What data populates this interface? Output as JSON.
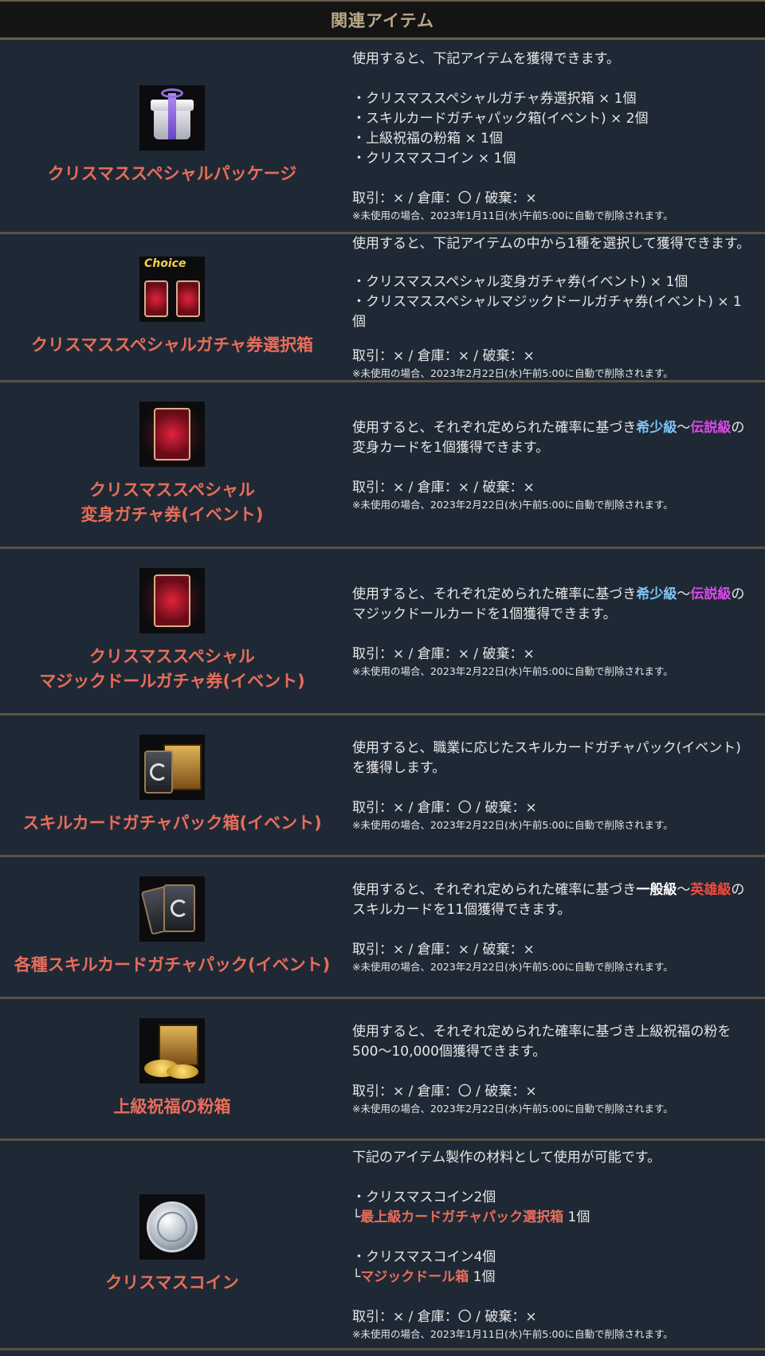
{
  "header": {
    "title": "関連アイテム"
  },
  "items": [
    {
      "name": "クリスマススペシャルパッケージ",
      "icon": "gift-box-icon",
      "lines": [
        "使用すると、下記アイテムを獲得できます。",
        "",
        "・クリスマススペシャルガチャ券選択箱 × 1個",
        "・スキルカードガチャパック箱(イベント) × 2個",
        "・上級祝福の粉箱 × 1個",
        "・クリスマスコイン × 1個",
        ""
      ],
      "trade": "取引：× / 倉庫：〇 / 破棄：×",
      "note": "※未使用の場合、2023年1月11日(水)午前5:00に自動で削除されます。"
    },
    {
      "name": "クリスマススペシャルガチャ券選択箱",
      "icon": "choice-box-icon",
      "icon_text": "Choice",
      "lines": [
        "使用すると、下記アイテムの中から1種を選択して獲得できます。",
        "",
        "・クリスマススペシャル変身ガチャ券(イベント) × 1個",
        "・クリスマススペシャルマジックドールガチャ券(イベント) × 1個",
        ""
      ],
      "trade": "取引：× / 倉庫：× / 破棄：×",
      "note": "※未使用の場合、2023年2月22日(水)午前5:00に自動で削除されます。"
    },
    {
      "name": "クリスマススペシャル\n変身ガチャ券(イベント)",
      "icon": "transform-card-icon",
      "desc": {
        "before": "使用すると、それぞれ定められた確率に基づき",
        "grade1": "希少級",
        "mid": "～",
        "grade2": "伝説級",
        "after": "の変身カードを1個獲得できます。"
      },
      "trade": "取引：× / 倉庫：× / 破棄：×",
      "note": "※未使用の場合、2023年2月22日(水)午前5:00に自動で削除されます。"
    },
    {
      "name": "クリスマススペシャル\nマジックドールガチャ券(イベント)",
      "icon": "magic-doll-card-icon",
      "desc": {
        "before": "使用すると、それぞれ定められた確率に基づき",
        "grade1": "希少級",
        "mid": "～",
        "grade2": "伝説級",
        "after": "のマジックドールカードを1個獲得できます。"
      },
      "trade": "取引：× / 倉庫：× / 破棄：×",
      "note": "※未使用の場合、2023年2月22日(水)午前5:00に自動で削除されます。"
    },
    {
      "name": "スキルカードガチャパック箱(イベント)",
      "icon": "skill-card-chest-icon",
      "lines": [
        "使用すると、職業に応じたスキルカードガチャパック(イベント)を獲得します。",
        ""
      ],
      "trade": "取引：× / 倉庫：〇 / 破棄：×",
      "note": "※未使用の場合、2023年2月22日(水)午前5:00に自動で削除されます。"
    },
    {
      "name": "各種スキルカードガチャパック(イベント)",
      "icon": "skill-card-pack-icon",
      "desc": {
        "before": "使用すると、それぞれ定められた確率に基づき",
        "grade1": "一般級",
        "mid": "～",
        "grade2": "英雄級",
        "after": "のスキルカードを11個獲得できます。"
      },
      "trade": "取引：× / 倉庫：× / 破棄：×",
      "note": "※未使用の場合、2023年2月22日(水)午前5:00に自動で削除されます。"
    },
    {
      "name": "上級祝福の粉箱",
      "icon": "blessing-powder-chest-icon",
      "lines": [
        "使用すると、それぞれ定められた確率に基づき上級祝福の粉を500～10,000個獲得できます。",
        ""
      ],
      "trade": "取引：× / 倉庫：〇 / 破棄：×",
      "note": "※未使用の場合、2023年2月22日(水)午前5:00に自動で削除されます。"
    },
    {
      "name": "クリスマスコイン",
      "icon": "christmas-coin-icon",
      "lines": [
        "下記のアイテム製作の材料として使用が可能です。",
        ""
      ],
      "recipes": [
        {
          "material": "・クリスマスコイン2個",
          "prefix": "└",
          "result": "最上級カードガチャパック選択箱",
          "qty": " 1個"
        },
        {
          "material": "・クリスマスコイン4個",
          "prefix": "└",
          "result": "マジックドール箱",
          "qty": " 1個"
        }
      ],
      "trade": "取引：× / 倉庫：〇 / 破棄：×",
      "note": "※未使用の場合、2023年1月11日(水)午前5:00に自動で削除されます。"
    }
  ]
}
